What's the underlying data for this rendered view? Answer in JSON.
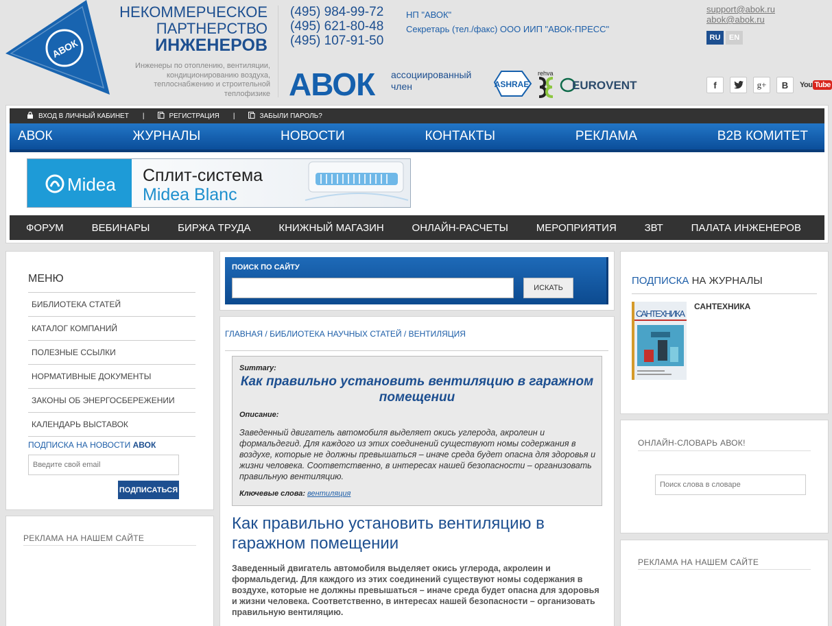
{
  "header": {
    "logo_text": "АВОК",
    "org_line1": "НЕКОММЕРЧЕСКОЕ",
    "org_line2": "ПАРТНЕРСТВО",
    "org_line3": "ИНЖЕНЕРОВ",
    "org_desc": "Инженеры по отоплению, вентиляции, кондиционированию воздуха, теплоснабжению и строительной теплофизике",
    "phones": [
      "(495) 984-99-72",
      "(495) 621-80-48",
      "(495) 107-91-50"
    ],
    "phone_notes": [
      "НП \"АВОК\"",
      "Секретарь (тел./факс) ООО ИИП \"АВОК-ПРЕСС\""
    ],
    "abok_big": "АВОК",
    "assoc_line1": "ассоциированный",
    "assoc_line2": "член",
    "partners": [
      "ASHRAE",
      "rehva",
      "EUROVENT"
    ],
    "emails": [
      "support@abok.ru",
      "abok@abok.ru"
    ],
    "lang": [
      "RU",
      "EN"
    ],
    "social": [
      "f",
      "g+",
      "B",
      "You",
      "Tube"
    ]
  },
  "topbar": {
    "login": "ВХОД В ЛИЧНЫЙ КАБИНЕТ",
    "register": "РЕГИСТРАЦИЯ",
    "forgot": "ЗАБЫЛИ ПАРОЛЬ?",
    "separator": "|"
  },
  "mainnav": [
    "АВОК",
    "ЖУРНАЛЫ",
    "НОВОСТИ",
    "КОНТАКТЫ",
    "РЕКЛАМА",
    "B2B КОМИТЕТ"
  ],
  "banner": {
    "brand": "Midea",
    "line1": "Сплит-система",
    "line2": "Midea Blanc"
  },
  "subnav": [
    "ФОРУМ",
    "ВЕБИНАРЫ",
    "БИРЖА ТРУДА",
    "КНИЖНЫЙ МАГАЗИН",
    "ОНЛАЙН-РАСЧЕТЫ",
    "МЕРОПРИЯТИЯ",
    "ЗВТ",
    "ПАЛАТА ИНЖЕНЕРОВ"
  ],
  "left": {
    "menu_title": "МЕНЮ",
    "menu": [
      "БИБЛИОТЕКА СТАТЕЙ",
      "КАТАЛОГ КОМПАНИЙ",
      "ПОЛЕЗНЫЕ ССЫЛКИ",
      "НОРМАТИВНЫЕ ДОКУМЕНТЫ",
      "ЗАКОНЫ ОБ ЭНЕРГОСБЕРЕЖЕНИИ",
      "КАЛЕНДАРЬ ВЫСТАВОК"
    ],
    "subscribe_title": "ПОДПИСКА НА НОВОСТИ",
    "subscribe_brand": "АВОК",
    "email_placeholder": "Введите свой email",
    "subscribe_button": "ПОДПИСАТЬСЯ",
    "ad_title": "РЕКЛАМА НА НАШЕМ САЙТЕ"
  },
  "search": {
    "label": "ПОИСК ПО САЙТУ",
    "button": "ИСКАТЬ"
  },
  "breadcrumb": [
    "ГЛАВНАЯ",
    "БИБЛИОТЕКА НАУЧНЫХ СТАТЕЙ",
    "ВЕНТИЛЯЦИЯ"
  ],
  "breadcrumb_sep": "/",
  "summary": {
    "label": "Summary:",
    "title": "Как правильно установить вентиляцию в гаражном помещении",
    "desc_label": "Описание:",
    "desc": "Заведенный двигатель автомобиля выделяет окись углерода, акролеин и формальдегид. Для каждого из этих соединений существуют номы содержания в воздухе, которые не должны превышаться – иначе среда будет опасна для здоровья и жизни человека. Соответственно, в интересах нашей безопасности – организовать правильную вентиляцию.",
    "kw_label": "Ключевые слова:",
    "kw": "вентиляция"
  },
  "article": {
    "title": "Как правильно установить вентиляцию в гаражном помещении",
    "lead": "Заведенный двигатель автомобиля выделяет окись углерода, акролеин и формальдегид. Для каждого из этих соединений существуют номы содержания в воздухе, которые не должны превышаться – иначе среда будет опасна для здоровья и жизни человека. Соответственно, в интересах нашей безопасности – организовать правильную вентиляцию."
  },
  "right": {
    "sub_title_a": "ПОДПИСКА",
    "sub_title_b": " НА ЖУРНАЛЫ",
    "magazine": "САНТЕХНИКА",
    "mag_cover_text": "САНТЕХНИКА",
    "dict_title": "ОНЛАЙН-СЛОВАРЬ АВОК!",
    "dict_placeholder": "Поиск слова в словаре",
    "ad_title": "РЕКЛАМА НА НАШЕМ САЙТЕ"
  },
  "colors": {
    "brand": "#1d4f90",
    "nav": "#1560ad",
    "dark": "#333333"
  }
}
